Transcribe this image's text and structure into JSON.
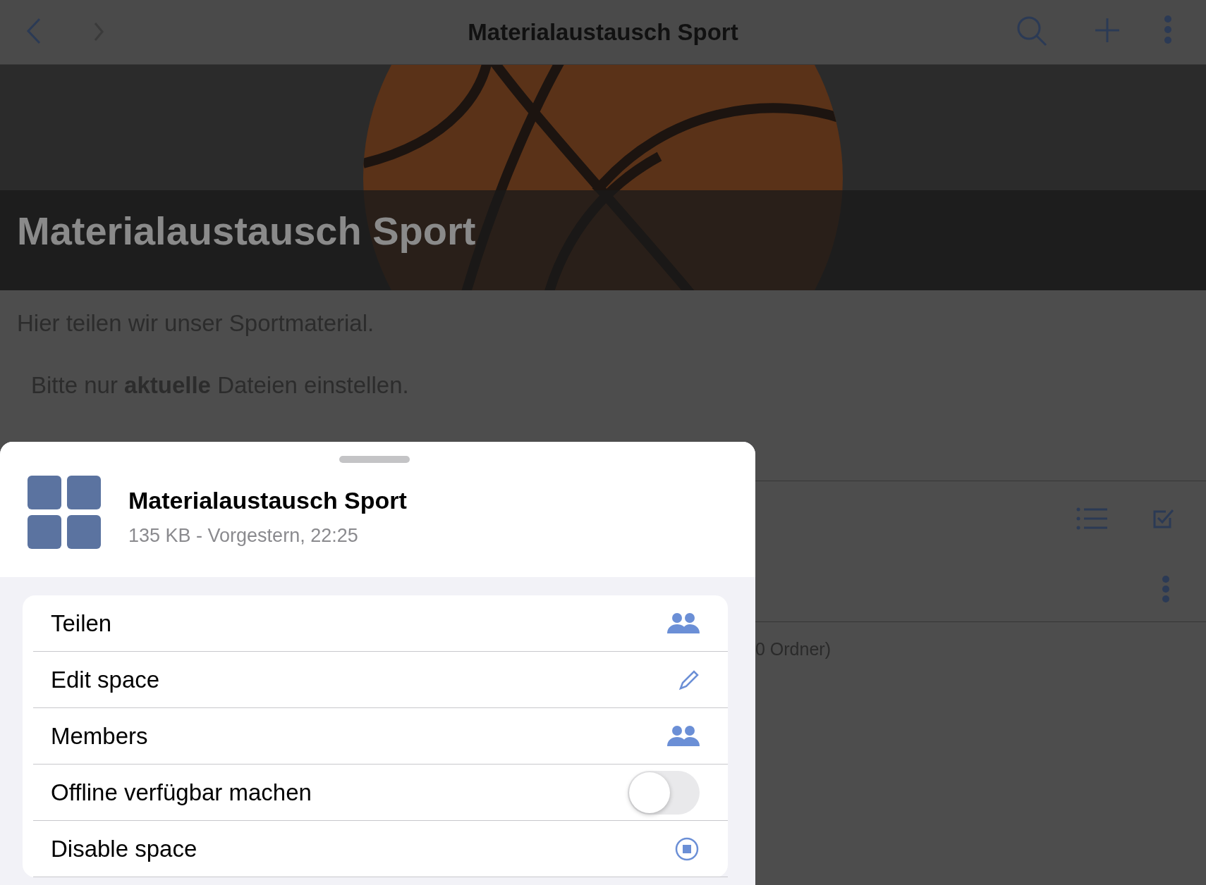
{
  "top_bar": {
    "title": "Materialaustausch Sport"
  },
  "header": {
    "title": "Materialaustausch Sport"
  },
  "description": {
    "intro": "Hier teilen wir unser Sportmaterial.",
    "note": "Bitte nur **aktuelle** Dateien einstellen."
  },
  "file_summary": "0 Ordner)",
  "sheet": {
    "title": "Materialaustausch Sport",
    "subtitle": "135 KB - Vorgestern, 22:25",
    "actions": [
      {
        "kind": "share",
        "label": "Teilen"
      },
      {
        "kind": "edit",
        "label": "Edit space"
      },
      {
        "kind": "members",
        "label": "Members"
      },
      {
        "kind": "toggle",
        "label": "Offline verfügbar machen",
        "on": false
      },
      {
        "kind": "disable",
        "label": "Disable space"
      }
    ]
  }
}
